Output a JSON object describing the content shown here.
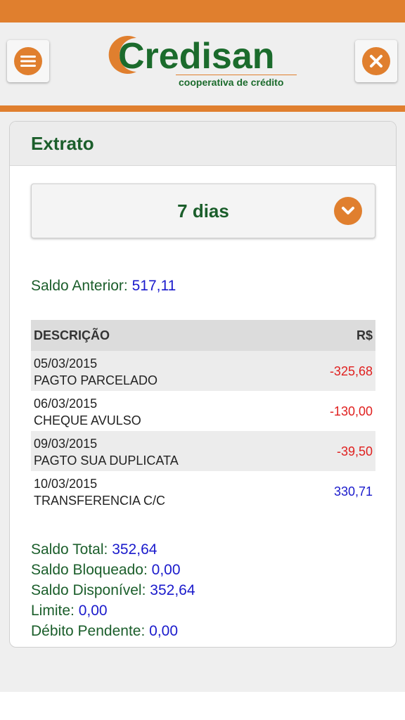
{
  "header": {
    "brand": "Credisan",
    "tagline": "cooperativa de crédito",
    "menu_icon": "hamburger-menu-icon",
    "close_icon": "close-x-icon",
    "accent_color": "#e07f2e",
    "brand_color": "#1b6b2c"
  },
  "card": {
    "title": "Extrato",
    "period": {
      "selected": "7 dias",
      "icon": "chevron-down-icon"
    },
    "saldo_anterior": {
      "label": "Saldo Anterior:",
      "value": "517,11"
    },
    "table": {
      "headers": {
        "description": "DESCRIÇÃO",
        "currency": "R$"
      },
      "rows": [
        {
          "date": "05/03/2015",
          "description": "PAGTO PARCELADO",
          "amount": "-325,68",
          "type": "debit"
        },
        {
          "date": "06/03/2015",
          "description": "CHEQUE AVULSO",
          "amount": "-130,00",
          "type": "debit"
        },
        {
          "date": "09/03/2015",
          "description": "PAGTO SUA DUPLICATA",
          "amount": "-39,50",
          "type": "debit"
        },
        {
          "date": "10/03/2015",
          "description": "TRANSFERENCIA C/C",
          "amount": "330,71",
          "type": "credit"
        }
      ]
    },
    "totals": [
      {
        "label": "Saldo Total:",
        "value": "352,64"
      },
      {
        "label": "Saldo Bloqueado:",
        "value": "0,00"
      },
      {
        "label": "Saldo Disponível:",
        "value": "352,64"
      },
      {
        "label": "Limite:",
        "value": "0,00"
      },
      {
        "label": "Débito Pendente:",
        "value": "0,00"
      }
    ]
  }
}
